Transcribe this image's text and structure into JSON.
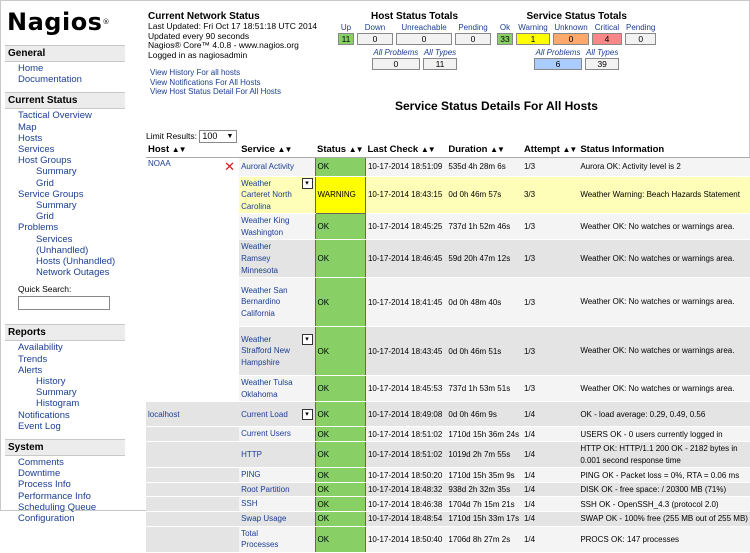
{
  "brand": {
    "name": "Nagios",
    "reg": "®"
  },
  "sidebar": {
    "general": {
      "title": "General",
      "items": [
        "Home",
        "Documentation"
      ]
    },
    "current_status": {
      "title": "Current Status",
      "items": [
        {
          "label": "Tactical Overview",
          "level": 1
        },
        {
          "label": "Map",
          "level": 1
        },
        {
          "label": "Hosts",
          "level": 1
        },
        {
          "label": "Services",
          "level": 1
        },
        {
          "label": "Host Groups",
          "level": 1
        },
        {
          "label": "Summary",
          "level": 3
        },
        {
          "label": "Grid",
          "level": 3
        },
        {
          "label": "Service Groups",
          "level": 1
        },
        {
          "label": "Summary",
          "level": 3
        },
        {
          "label": "Grid",
          "level": 3
        },
        {
          "label": "Problems",
          "level": 1
        },
        {
          "label": "Services (Unhandled)",
          "level": 3
        },
        {
          "label": "Hosts (Unhandled)",
          "level": 3
        },
        {
          "label": "Network Outages",
          "level": 3
        }
      ],
      "quick_search_label": "Quick Search:"
    },
    "reports": {
      "title": "Reports",
      "items": [
        {
          "label": "Availability",
          "level": 1
        },
        {
          "label": "Trends",
          "level": 1
        },
        {
          "label": "Alerts",
          "level": 1
        },
        {
          "label": "History",
          "level": 3
        },
        {
          "label": "Summary",
          "level": 3
        },
        {
          "label": "Histogram",
          "level": 3
        },
        {
          "label": "Notifications",
          "level": 1
        },
        {
          "label": "Event Log",
          "level": 1
        }
      ]
    },
    "system": {
      "title": "System",
      "items": [
        "Comments",
        "Downtime",
        "Process Info",
        "Performance Info",
        "Scheduling Queue",
        "Configuration"
      ]
    }
  },
  "header": {
    "title": "Current Network Status",
    "last_updated": "Last Updated: Fri Oct 17 18:51:18 UTC 2014",
    "update_interval": "Updated every 90 seconds",
    "version": "Nagios® Core™ 4.0.8 - www.nagios.org",
    "logged_in": "Logged in as nagiosadmin",
    "links": [
      "View History For all hosts",
      "View Notifications For All Hosts",
      "View Host Status Detail For All Hosts"
    ]
  },
  "host_totals": {
    "title": "Host Status Totals",
    "labels": [
      "Up",
      "Down",
      "Unreachable",
      "Pending"
    ],
    "values": [
      "11",
      "0",
      "0",
      "0"
    ],
    "sub_labels": [
      "All Problems",
      "All Types"
    ],
    "sub_values": [
      "0",
      "11"
    ]
  },
  "service_totals": {
    "title": "Service Status Totals",
    "labels": [
      "Ok",
      "Warning",
      "Unknown",
      "Critical",
      "Pending"
    ],
    "values": [
      "33",
      "1",
      "0",
      "4",
      "0"
    ],
    "sub_labels": [
      "All Problems",
      "All Types"
    ],
    "sub_values": [
      "6",
      "39"
    ]
  },
  "colors": {
    "ok": "#88d066",
    "warning": "#ffff00",
    "unknown": "#ffa86c",
    "critical": "#f88888",
    "problems": "#aaccff",
    "link": "#1b3f93"
  },
  "details": {
    "title": "Service Status Details For All Hosts",
    "limit_label": "Limit Results:",
    "limit_value": "100",
    "columns": [
      "Host",
      "Service",
      "Status",
      "Last Check",
      "Duration",
      "Attempt",
      "Status Information"
    ],
    "rows": [
      {
        "host": "NOAA",
        "service": "Auroral Activity",
        "status": "OK",
        "last_check": "10-17-2014 18:51:09",
        "duration": "535d 4h 28m 6s",
        "attempt": "1/3",
        "info": "Aurora OK: Activity level is 2",
        "h": 14
      },
      {
        "host": "",
        "service": "Weather Carteret North Carolina",
        "status": "WARNING",
        "last_check": "10-17-2014 18:43:15",
        "duration": "0d 0h 46m 57s",
        "attempt": "3/3",
        "info": "Weather Warning: Beach Hazards Statement",
        "h": 30
      },
      {
        "host": "",
        "service": "Weather King Washington",
        "status": "OK",
        "last_check": "10-17-2014 18:45:25",
        "duration": "737d 1h 52m 46s",
        "attempt": "1/3",
        "info": "Weather OK: No watches or warnings area.",
        "h": 26
      },
      {
        "host": "",
        "service": "Weather Ramsey Minnesota",
        "status": "OK",
        "last_check": "10-17-2014 18:46:45",
        "duration": "59d 20h 47m 12s",
        "attempt": "1/3",
        "info": "Weather OK: No watches or warnings area.",
        "h": 25
      },
      {
        "host": "",
        "service": "Weather San Bernardino California",
        "status": "OK",
        "last_check": "10-17-2014 18:41:45",
        "duration": "0d 0h 48m 40s",
        "attempt": "1/3",
        "info": "Weather OK: No watches or warnings area.",
        "h": 49
      },
      {
        "host": "",
        "service": "Weather Strafford New Hampshire",
        "status": "OK",
        "last_check": "10-17-2014 18:43:45",
        "duration": "0d 0h 46m 51s",
        "attempt": "1/3",
        "info": "Weather OK: No watches or warnings area.",
        "h": 49
      },
      {
        "host": "",
        "service": "Weather Tulsa Oklahoma",
        "status": "OK",
        "last_check": "10-17-2014 18:45:53",
        "duration": "737d 1h 53m 51s",
        "attempt": "1/3",
        "info": "Weather OK: No watches or warnings area.",
        "h": 26
      },
      {
        "host": "localhost",
        "service": "Current Load",
        "status": "OK",
        "last_check": "10-17-2014 18:49:08",
        "duration": "0d 0h 46m 9s",
        "attempt": "1/4",
        "info": "OK - load average: 0.29, 0.49, 0.56",
        "h": 25
      },
      {
        "host": "",
        "service": "Current Users",
        "status": "OK",
        "last_check": "10-17-2014 18:51:02",
        "duration": "1710d 15h 36m 24s",
        "attempt": "1/4",
        "info": "USERS OK - 0 users currently logged in",
        "h": 13
      },
      {
        "host": "",
        "service": "HTTP",
        "status": "OK",
        "last_check": "10-17-2014 18:51:02",
        "duration": "1019d 2h 7m 55s",
        "attempt": "1/4",
        "info": "HTTP OK: HTTP/1.1 200 OK - 2182 bytes in 0.001 second response time",
        "h": 25
      },
      {
        "host": "",
        "service": "PING",
        "status": "OK",
        "last_check": "10-17-2014 18:50:20",
        "duration": "1710d 15h 35m 9s",
        "attempt": "1/4",
        "info": "PING OK - Packet loss = 0%, RTA = 0.06 ms",
        "h": 13
      },
      {
        "host": "",
        "service": "Root Partition",
        "status": "OK",
        "last_check": "10-17-2014 18:48:32",
        "duration": "938d 2h 32m 35s",
        "attempt": "1/4",
        "info": "DISK OK - free space: / 20300 MB (71%)",
        "h": 13
      },
      {
        "host": "",
        "service": "SSH",
        "status": "OK",
        "last_check": "10-17-2014 18:46:38",
        "duration": "1704d 7h 15m 21s",
        "attempt": "1/4",
        "info": "SSH OK - OpenSSH_4.3 (protocol 2.0)",
        "h": 13
      },
      {
        "host": "",
        "service": "Swap Usage",
        "status": "OK",
        "last_check": "10-17-2014 18:48:54",
        "duration": "1710d 15h 33m 17s",
        "attempt": "1/4",
        "info": "SWAP OK - 100% free (255 MB out of 255 MB)",
        "h": 13
      },
      {
        "host": "",
        "service": "Total Processes",
        "status": "OK",
        "last_check": "10-17-2014 18:50:40",
        "duration": "1706d 8h 27m 2s",
        "attempt": "1/4",
        "info": "PROCS OK: 147 processes",
        "h": 13
      }
    ]
  }
}
